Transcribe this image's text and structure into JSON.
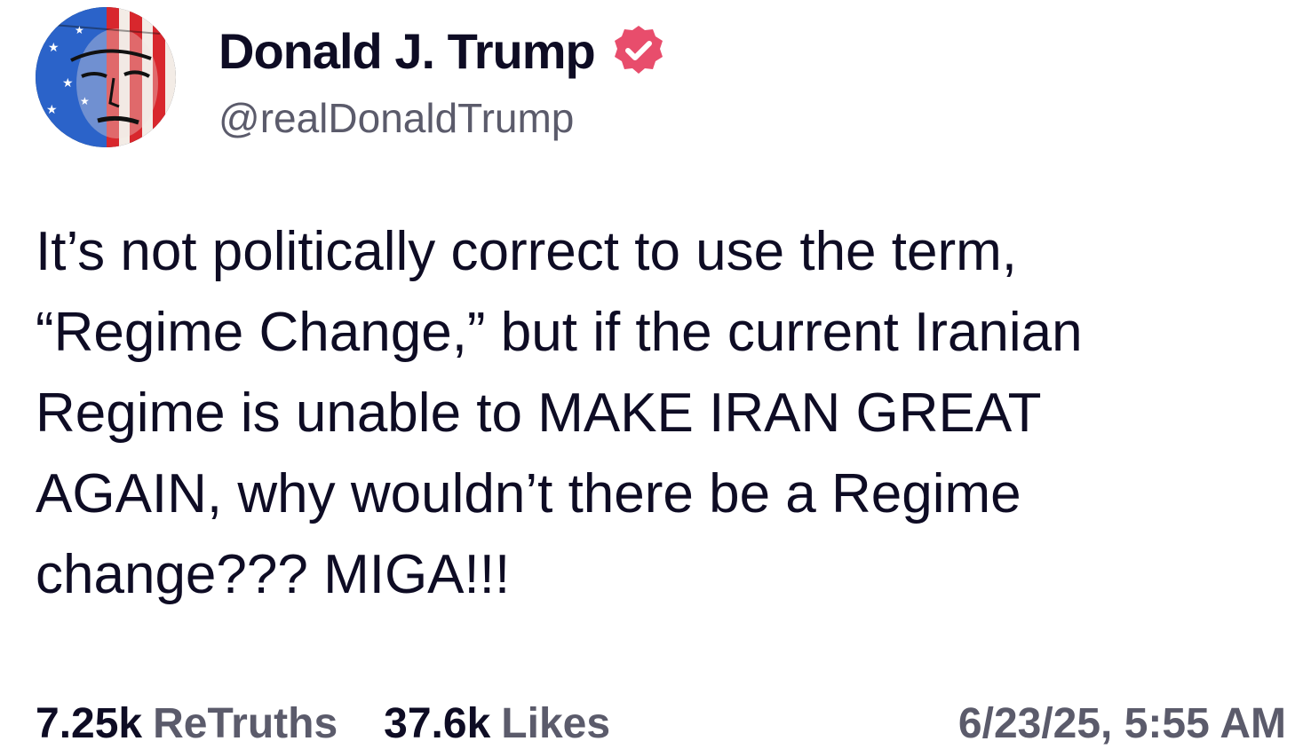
{
  "author": {
    "display_name": "Donald J. Trump",
    "handle": "@realDonaldTrump",
    "verified": true,
    "verified_badge_color": "#e84d6c",
    "avatar": "flag-painted-portrait"
  },
  "post": {
    "text": "It’s not politically correct to use the term,\n“Regime Change,” but if the current Iranian\nRegime is unable to MAKE IRAN GREAT\nAGAIN, why wouldn’t there be a Regime\nchange??? MIGA!!!"
  },
  "stats": {
    "retruths_count": "7.25k",
    "retruths_label": "ReTruths",
    "likes_count": "37.6k",
    "likes_label": "Likes"
  },
  "timestamp": "6/23/25, 5:55 AM",
  "colors": {
    "text_primary": "#0e0c24",
    "text_secondary": "#5b5b6b",
    "background": "#ffffff"
  }
}
